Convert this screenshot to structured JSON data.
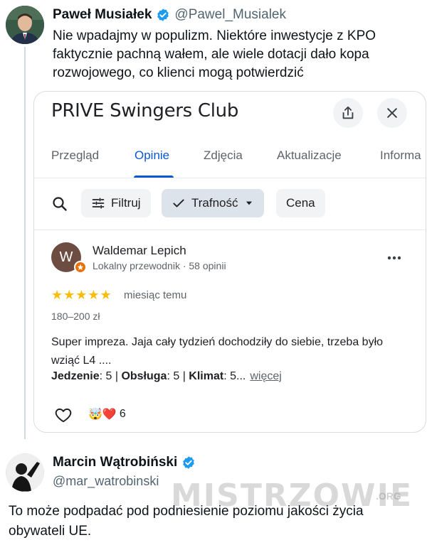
{
  "tweet1": {
    "name": "Paweł Musiałek",
    "handle": "@Pawel_Musialek",
    "text": "Nie wpadajmy w populizm. Niektóre inwestycje z KPO faktycznie pachną wałem, ale wiele dotacji dało kopa rozwojowego, co klienci mogą potwierdzić"
  },
  "card": {
    "title": "PRIVE Swingers Club",
    "tabs": [
      "Przegląd",
      "Opinie",
      "Zdjęcia",
      "Aktualizacje",
      "Informa"
    ],
    "active_tab": "Opinie",
    "filters": {
      "filter_label": "Filtruj",
      "sort_label": "Trafność",
      "price_label": "Cena"
    },
    "review": {
      "avatar_letter": "W",
      "author": "Waldemar Lepich",
      "meta": "Lokalny przewodnik · 58 opinii",
      "rating": 5,
      "stars": "★★★★★",
      "time": "miesiąc temu",
      "price": "180–200 zł",
      "text": "Super impreza.  Jaja cały tydzień dochodziły do siebie, trzeba było wziąć L4 ....",
      "ratings": [
        {
          "label": "Jedzenie",
          "value": ": 5 | "
        },
        {
          "label": "Obsługa",
          "value": ": 5 | "
        },
        {
          "label": "Klimat",
          "value": ": 5..."
        }
      ],
      "more_link": "więcej",
      "reaction_emojis": "🤯❤️",
      "reaction_count": "6"
    }
  },
  "tweet2": {
    "name": "Marcin Wątrobiński",
    "handle": "@mar_watrobinski",
    "text": "To może podpadać pod podniesienie poziomu jakości życia obywateli UE."
  },
  "watermark": {
    "text": "MISTRZOWIE",
    "suffix": ".ORG"
  },
  "colors": {
    "verified": "#1d9bf0",
    "active_tab": "#0b57d0",
    "star": "#fbbc04",
    "guide_badge": "#e8710a"
  },
  "icons": [
    "verified-icon",
    "share-icon",
    "close-icon",
    "search-icon",
    "filter-icon",
    "check-icon",
    "dropdown-icon",
    "more-icon",
    "heart-icon"
  ]
}
